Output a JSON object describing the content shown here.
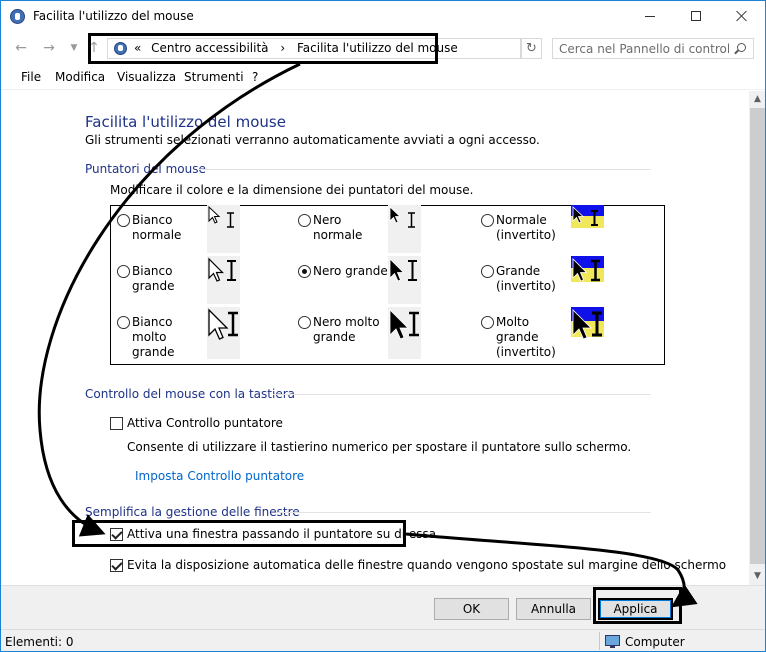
{
  "window": {
    "title": "Facilita l'utilizzo del mouse",
    "accent": "#1883d7"
  },
  "navigation": {
    "breadcrumb_prefix": "«",
    "breadcrumb_sep": "›",
    "breadcrumbs": [
      "Centro accessibilità",
      "Facilita l'utilizzo del mouse"
    ],
    "search_placeholder": "Cerca nel Pannello di controllo"
  },
  "menu": [
    "File",
    "Modifica",
    "Visualizza",
    "Strumenti",
    "?"
  ],
  "page": {
    "title": "Facilita l'utilizzo del mouse",
    "subtitle": "Gli strumenti selezionati verranno automaticamente avviati a ogni accesso.",
    "title_color": "#1e3287"
  },
  "pointers": {
    "heading": "Puntatori del mouse",
    "description": "Modificare il colore e la dimensione dei puntatori del mouse.",
    "options": [
      {
        "label_1": "Bianco",
        "label_2": "normale",
        "label_3": "",
        "selected": false
      },
      {
        "label_1": "Nero",
        "label_2": "normale",
        "label_3": "",
        "selected": false
      },
      {
        "label_1": "Normale",
        "label_2": "(invertito)",
        "label_3": "",
        "selected": false
      },
      {
        "label_1": "Bianco",
        "label_2": "grande",
        "label_3": "",
        "selected": false
      },
      {
        "label_1": "Nero grande",
        "label_2": "",
        "label_3": "",
        "selected": true
      },
      {
        "label_1": "Grande",
        "label_2": "(invertito)",
        "label_3": "",
        "selected": false
      },
      {
        "label_1": "Bianco",
        "label_2": "molto",
        "label_3": "grande",
        "selected": false
      },
      {
        "label_1": "Nero molto",
        "label_2": "grande",
        "label_3": "",
        "selected": false
      },
      {
        "label_1": "Molto",
        "label_2": "grande",
        "label_3": "(invertito)",
        "selected": false
      }
    ]
  },
  "keyboard_control": {
    "heading": "Controllo del mouse con la tastiera",
    "checkbox_label": "Attiva Controllo puntatore",
    "checked": false,
    "description": "Consente di utilizzare il tastierino numerico per spostare il puntatore sullo schermo.",
    "link": "Imposta Controllo puntatore"
  },
  "window_management": {
    "heading": "Semplifica la gestione delle finestre",
    "option_1": {
      "label": "Attiva una finestra passando il puntatore su di essa",
      "checked": true
    },
    "option_2": {
      "label": "Evita la disposizione automatica delle finestre quando vengono spostate sul margine dello schermo",
      "checked": true
    }
  },
  "buttons": {
    "ok": "OK",
    "cancel": "Annulla",
    "apply": "Applica"
  },
  "status": {
    "items": "Elementi: 0",
    "location": "Computer"
  }
}
